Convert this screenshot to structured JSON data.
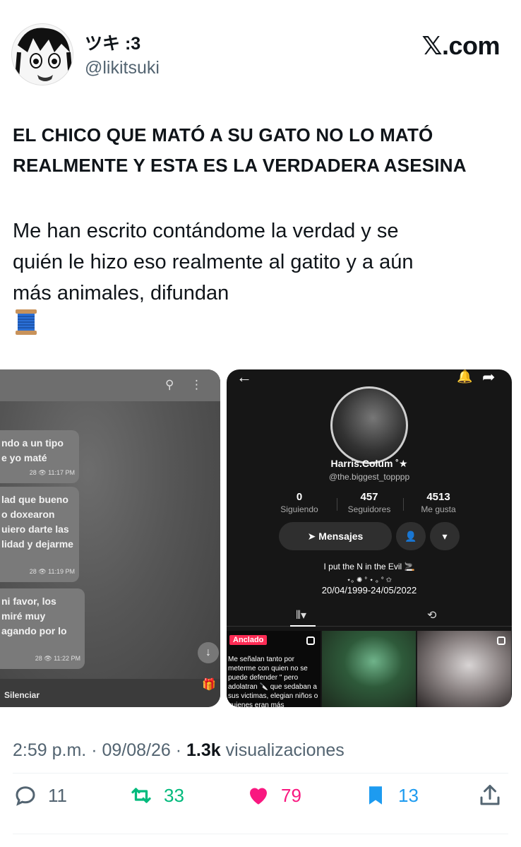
{
  "author": {
    "display_name": "ツキ :3",
    "handle": "@likitsuki"
  },
  "brand": {
    "logo_text": ".com",
    "logo_x": "𝕏"
  },
  "tweet": {
    "headline_line1": "EL CHICO QUE MATÓ A SU GATO NO LO MATÓ",
    "headline_line2": "REALMENTE Y ESTA ES LA VERDADERA ASESINA",
    "body_line1": "Me han escrito contándome la verdad y se",
    "body_line2": "quién le hizo eso realmente al gatito y a aún",
    "body_line3": "más animales, difundan",
    "emoji": "spool-of-thread-emoji"
  },
  "chat": {
    "bubbles": [
      {
        "line1": "ndo a un tipo",
        "line2": "e yo maté",
        "meta": "28 👁 11:17 PM"
      },
      {
        "line1": "lad que bueno",
        "line2": "o doxearon",
        "line3": "uiero darte las",
        "line4": "lidad y dejarme",
        "meta": "28 👁 11:19 PM"
      },
      {
        "line1": "ni favor, los",
        "line2": "miré muy",
        "line3": "agando por lo",
        "meta": "28 👁 11:22 PM"
      }
    ],
    "mute_label": "Silenciar"
  },
  "profile": {
    "name": "Harris.Colum ˚★",
    "username": "@the.biggest_topppp",
    "stats": [
      {
        "value": "0",
        "label": "Siguiendo"
      },
      {
        "value": "457",
        "label": "Seguidores"
      },
      {
        "value": "4513",
        "label": "Me gusta"
      }
    ],
    "message_button": "Mensajes",
    "bio_line1": "I put the N in the Evil 🚬",
    "bio_line2": "⋆｡ ✺ ° ⋆ ｡ °  ✩",
    "bio_line3": "20/04/1999-24/05/2022",
    "pinned_label": "Anclado",
    "pinned_text": "Me señalan tanto por meterme con quien no se puede defender \" pero adolatran 🔪 que sedaban a sus victimas, elegian niños o quienes eran más"
  },
  "footer": {
    "time": "2:59 p.m.",
    "dot": "·",
    "date": "09/08/26",
    "views_count": "1.3k",
    "views_label": "visualizaciones"
  },
  "actions": {
    "replies": "11",
    "retweets": "33",
    "likes": "79",
    "bookmarks": "13"
  },
  "colors": {
    "retweet": "#00ba7c",
    "like": "#f91880",
    "bookmark": "#1d9bf0",
    "muted": "#536471"
  }
}
